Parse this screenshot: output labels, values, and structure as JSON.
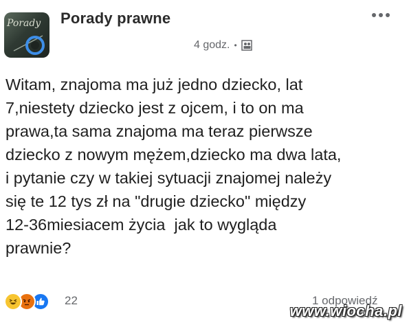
{
  "header": {
    "page_name": "Porady prawne",
    "avatar_text": "Porady",
    "timestamp": "4 godz.",
    "separator": "•",
    "audience_icon": "group-audience-icon",
    "more_icon": "more-options-icon"
  },
  "post": {
    "lines": [
      "Witam, znajoma ma już jedno dziecko, lat",
      "7,niestety dziecko jest z ojcem, i to on ma",
      "prawa,ta sama znajoma ma teraz pierwsze",
      "dziecko z nowym mężem,dziecko ma dwa lata,",
      "i pytanie czy w takiej sytuacji znajomej należy",
      "się te 12 tys zł na \"drugie dziecko\" między",
      "12-36miesiacem życia  jak to wygląda",
      "prawnie?"
    ]
  },
  "footer": {
    "reactions": [
      "haha-reaction-icon",
      "angry-reaction-icon",
      "like-reaction-icon"
    ],
    "reaction_count": "22",
    "comments": "1 odpowiedź"
  },
  "watermark": "www.wiocha.pl",
  "colors": {
    "text": "#1f1f1f",
    "meta": "#65676b",
    "like_blue": "#1877f2",
    "haha_yellow": "#f7c531",
    "angry_orange": "#e9710f"
  }
}
